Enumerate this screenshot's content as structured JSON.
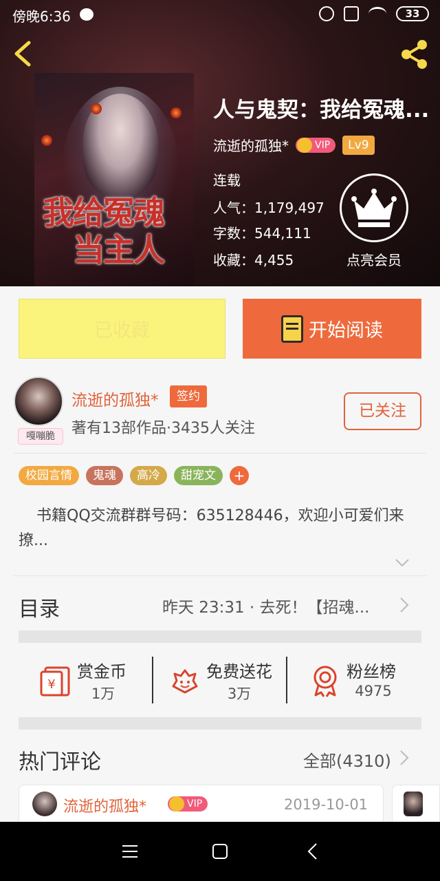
{
  "status_bar": {
    "time": "傍晚6:36",
    "battery": "33"
  },
  "book": {
    "cover_title_line1": "我给冤魂",
    "cover_title_line2": "当主人",
    "title": "人与鬼契：我给冤魂...",
    "author": "流逝的孤独*",
    "vip": "VIP",
    "level": "Lv9",
    "status": "连载",
    "popularity": "人气：1,179,497",
    "word_count": "字数：544,111",
    "favorites": "收藏：4,455",
    "member_label": "点亮会员"
  },
  "actions": {
    "collected": "已收藏",
    "start_reading": "开始阅读"
  },
  "author_card": {
    "avatar_tag": "嘎嘣脆",
    "name": "流逝的孤独*",
    "signed": "签约",
    "meta": "著有13部作品·3435人关注",
    "follow": "已关注"
  },
  "tags": [
    {
      "label": "校园言情",
      "color": "#f2a941"
    },
    {
      "label": "鬼魂",
      "color": "#c7745e"
    },
    {
      "label": "高冷",
      "color": "#d4a94a"
    },
    {
      "label": "甜宠文",
      "color": "#8ab45a"
    }
  ],
  "tag_add": "+",
  "intro": "书籍QQ交流群群号码：635128446，欢迎小可爱们来撩...",
  "catalog": {
    "title": "目录",
    "latest": "昨天 23:31 · 去死！【招魂..."
  },
  "rewards": [
    {
      "label": "赏金币",
      "value": "1万",
      "icon": "red-envelope-icon"
    },
    {
      "label": "免费送花",
      "value": "3万",
      "icon": "flower-icon"
    },
    {
      "label": "粉丝榜",
      "value": "4975",
      "icon": "medal-icon"
    }
  ],
  "hot_comments": {
    "title": "热门评论",
    "all": "全部(4310)",
    "first": {
      "name": "流逝的孤独*",
      "vip": "VIP",
      "date": "2019-10-01"
    }
  },
  "colors": {
    "accent": "#ee6a3c",
    "collect_bg": "#fbf47c",
    "author_name": "#e0633a"
  }
}
